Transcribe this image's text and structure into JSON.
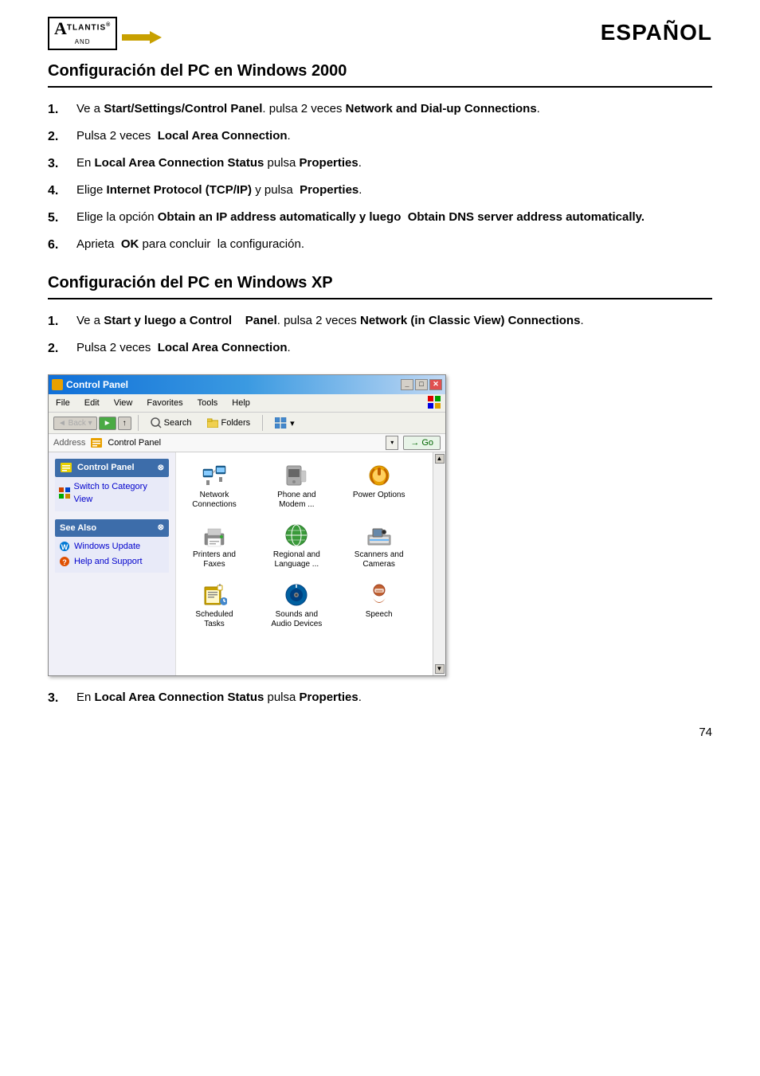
{
  "header": {
    "logo_a": "A",
    "logo_tlantis": "TLANTIS",
    "logo_registered": "®",
    "logo_and": "AND",
    "espanol": "ESPAÑOL"
  },
  "section_win2000": {
    "title": "Configuración del  PC en Windows 2000",
    "steps": [
      {
        "num": "1.",
        "text_parts": [
          {
            "text": "Ve a ",
            "bold": false
          },
          {
            "text": "Start/Settings/Control Panel",
            "bold": true
          },
          {
            "text": ". pulsa 2 veces ",
            "bold": false
          },
          {
            "text": "Network and Dial-up Connections",
            "bold": true
          },
          {
            "text": ".",
            "bold": false
          }
        ]
      },
      {
        "num": "2.",
        "text_parts": [
          {
            "text": "Pulsa 2 veces  ",
            "bold": false
          },
          {
            "text": "Local Area Connection",
            "bold": true
          },
          {
            "text": ".",
            "bold": false
          }
        ]
      },
      {
        "num": "3.",
        "text_parts": [
          {
            "text": "En ",
            "bold": false
          },
          {
            "text": "Local Area Connection Status",
            "bold": true
          },
          {
            "text": " pulsa ",
            "bold": false
          },
          {
            "text": "Properties",
            "bold": true
          },
          {
            "text": ".",
            "bold": false
          }
        ]
      },
      {
        "num": "4.",
        "text_parts": [
          {
            "text": "Elige ",
            "bold": false
          },
          {
            "text": "Internet Protocol (TCP/IP)",
            "bold": true
          },
          {
            "text": " y pulsa  ",
            "bold": false
          },
          {
            "text": "Properties",
            "bold": true
          },
          {
            "text": ".",
            "bold": false
          }
        ]
      },
      {
        "num": "5.",
        "text_parts": [
          {
            "text": "Elige la opción ",
            "bold": false
          },
          {
            "text": "Obtain an IP address automatically y luego  Obtain DNS server address automatically.",
            "bold": true
          }
        ]
      },
      {
        "num": "6.",
        "text_parts": [
          {
            "text": "Aprieta  ",
            "bold": false
          },
          {
            "text": "OK",
            "bold": true
          },
          {
            "text": " para concluir  la configuración.",
            "bold": false
          }
        ]
      }
    ]
  },
  "section_winxp": {
    "title": "Configuración del  PC en Windows XP",
    "steps_before_img": [
      {
        "num": "1.",
        "text_parts": [
          {
            "text": "Ve a ",
            "bold": false
          },
          {
            "text": "Start y luego a Control    Panel",
            "bold": true
          },
          {
            "text": ". pulsa 2 veces ",
            "bold": false
          },
          {
            "text": "Network (in Classic View) Connections",
            "bold": true
          },
          {
            "text": ".",
            "bold": false
          }
        ]
      },
      {
        "num": "2.",
        "text_parts": [
          {
            "text": "Pulsa 2 veces  ",
            "bold": false
          },
          {
            "text": "Local Area Connection",
            "bold": true
          },
          {
            "text": ".",
            "bold": false
          }
        ]
      }
    ],
    "screenshot": {
      "title": "Control Panel",
      "menubar": [
        "File",
        "Edit",
        "View",
        "Favorites",
        "Tools",
        "Help"
      ],
      "toolbar": {
        "back": "Back",
        "forward": "→",
        "search": "Search",
        "folders": "Folders"
      },
      "address_label": "Address",
      "address_value": "Control Panel",
      "go_label": "Go",
      "sidebar": {
        "control_panel_header": "Control Panel",
        "switch_view_link": "Switch to Category View",
        "see_also_header": "See Also",
        "links": [
          "Windows Update",
          "Help and Support"
        ]
      },
      "icons": [
        {
          "label": "Network\nConnections",
          "icon": "network"
        },
        {
          "label": "Phone and\nModem ...",
          "icon": "phone"
        },
        {
          "label": "Power Options",
          "icon": "power"
        },
        {
          "label": "Printers and\nFaxes",
          "icon": "printer"
        },
        {
          "label": "Regional and\nLanguage ...",
          "icon": "regional"
        },
        {
          "label": "Scanners and\nCameras",
          "icon": "scanner"
        },
        {
          "label": "Scheduled\nTasks",
          "icon": "tasks"
        },
        {
          "label": "Sounds and\nAudio Devices",
          "icon": "sounds"
        },
        {
          "label": "Speech",
          "icon": "speech"
        }
      ]
    },
    "step_after_img": {
      "num": "3.",
      "text_parts": [
        {
          "text": "En ",
          "bold": false
        },
        {
          "text": "Local Area Connection Status",
          "bold": true
        },
        {
          "text": " pulsa ",
          "bold": false
        },
        {
          "text": "Properties",
          "bold": true
        },
        {
          "text": ".",
          "bold": false
        }
      ]
    }
  },
  "page_number": "74"
}
